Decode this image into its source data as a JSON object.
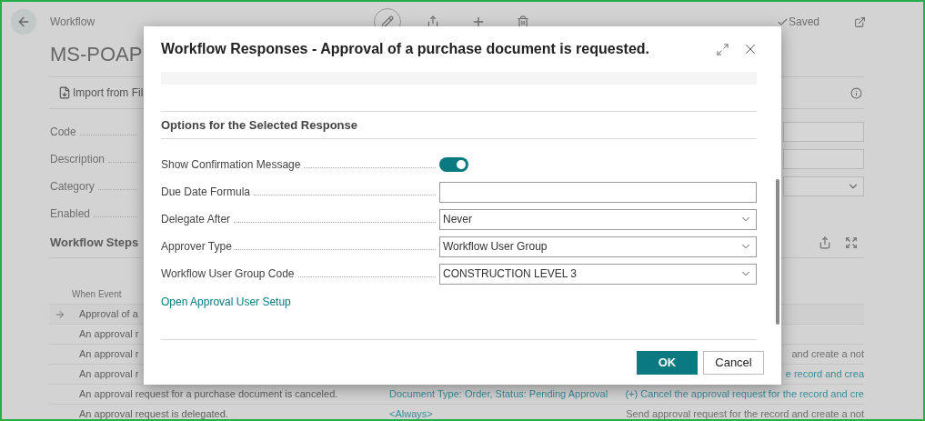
{
  "page": {
    "breadcrumb": "Workflow",
    "title": "MS-POAP",
    "saved": "Saved",
    "action": "Import from Fil",
    "fields": [
      {
        "label": "Code",
        "kind": "text"
      },
      {
        "label": "Description",
        "kind": "text"
      },
      {
        "label": "Category",
        "kind": "dropdown"
      },
      {
        "label": "Enabled",
        "kind": "blank"
      }
    ],
    "steps": {
      "title": "Workflow Steps",
      "column_1": "When Event",
      "rows": [
        {
          "selected": true,
          "event": "Approval of a"
        },
        {
          "selected": false,
          "event": "An approval r"
        },
        {
          "selected": false,
          "event": "An approval r",
          "response": {
            "text": "and create a not",
            "link": false
          }
        },
        {
          "selected": false,
          "event": "An approval r",
          "response": {
            "text": "e record and crea",
            "link": true
          }
        },
        {
          "selected": false,
          "event": "An approval request for a purchase document is canceled.",
          "condition": "Document Type: Order, Status: Pending Approval",
          "response": {
            "text": "(+) Cancel the approval request for the record and cre",
            "link": true
          }
        },
        {
          "selected": false,
          "event": "An approval request is delegated.",
          "condition": "<Always>",
          "response": {
            "text": "Send approval request for the record and create a not",
            "link": false
          }
        }
      ]
    }
  },
  "dialog": {
    "title": "Workflow Responses - Approval of a purchase document is requested.",
    "section": "Options for the Selected Response",
    "fields": [
      {
        "label": "Show Confirmation Message",
        "kind": "toggle",
        "on": true
      },
      {
        "label": "Due Date Formula",
        "kind": "text"
      },
      {
        "label": "Delegate After",
        "kind": "select",
        "value": "Never"
      },
      {
        "label": "Approver Type",
        "kind": "select",
        "value": "Workflow User Group"
      },
      {
        "label": "Workflow User Group Code",
        "kind": "select",
        "value": "CONSTRUCTION LEVEL 3"
      }
    ],
    "link": "Open Approval User Setup",
    "buttons": [
      {
        "label": "OK",
        "kind": "primary"
      },
      {
        "label": "Cancel",
        "kind": "secondary"
      }
    ]
  }
}
